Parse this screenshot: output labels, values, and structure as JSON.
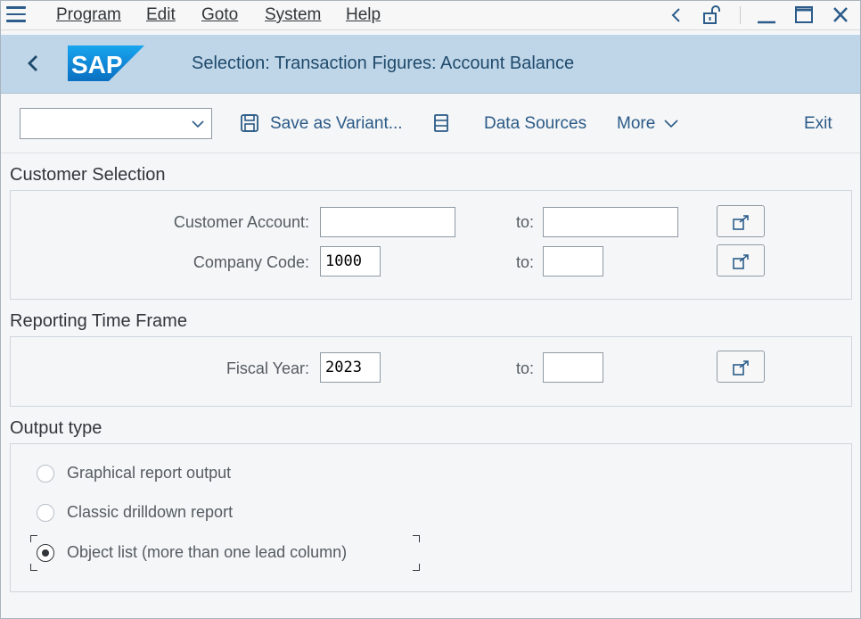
{
  "menu": {
    "items": [
      {
        "label": "Program"
      },
      {
        "label": "Edit"
      },
      {
        "label": "Goto"
      },
      {
        "label": "System"
      },
      {
        "label": "Help"
      }
    ]
  },
  "header": {
    "logo_text": "SAP",
    "title": "Selection: Transaction Figures: Account Balance"
  },
  "toolbar": {
    "variant_value": "",
    "save_variant_label": "Save as Variant...",
    "data_sources_label": "Data Sources",
    "more_label": "More",
    "exit_label": "Exit"
  },
  "customer_selection": {
    "title": "Customer Selection",
    "customer_account_label": "Customer Account:",
    "customer_account_from": "",
    "customer_account_to": "",
    "company_code_label": "Company Code:",
    "company_code_from": "1000",
    "company_code_to": "",
    "to_label": "to:"
  },
  "time_frame": {
    "title": "Reporting Time Frame",
    "fiscal_year_label": "Fiscal Year:",
    "fiscal_year_from": "2023",
    "fiscal_year_to": "",
    "to_label": "to:"
  },
  "output_type": {
    "title": "Output type",
    "options": [
      {
        "label": "Graphical report output",
        "selected": false
      },
      {
        "label": "Classic drilldown report",
        "selected": false
      },
      {
        "label": "Object list (more than one lead column)",
        "selected": true
      }
    ]
  },
  "colors": {
    "title_bar": "#bfd5e8",
    "link_blue": "#2b5a86",
    "sap_logo_blue": "#1c8ad8"
  }
}
